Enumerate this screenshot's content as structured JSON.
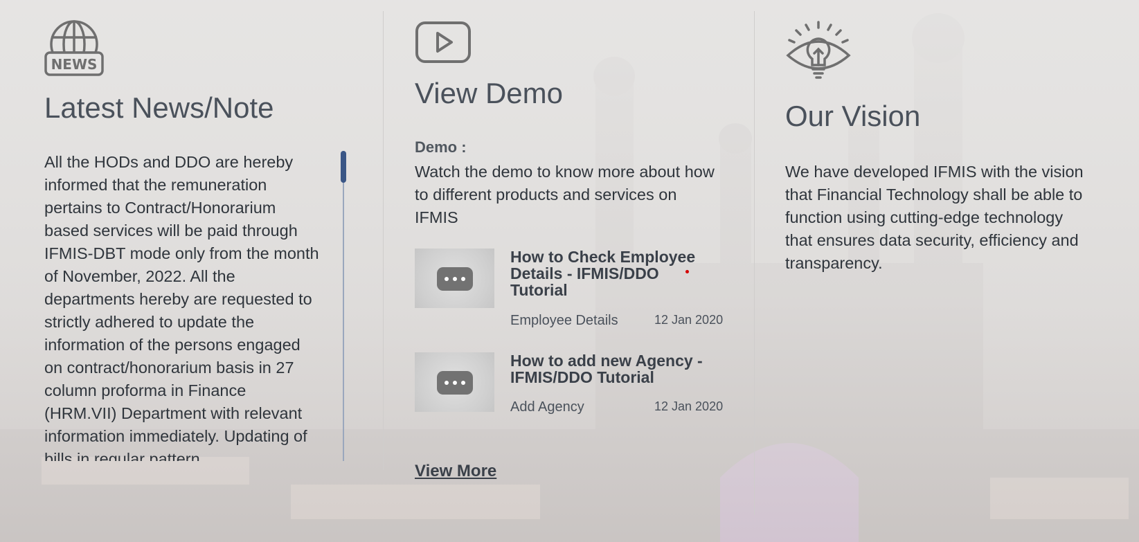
{
  "news": {
    "icon": "news-globe-icon",
    "icon_label": "NEWS",
    "title": "Latest News/Note",
    "body": "All the HODs and DDO are hereby informed that the remuneration pertains to Contract/Honorarium based services will be paid through IFMIS-DBT mode only from the month of November, 2022. All the departments hereby are requested to strictly adhered to update the information of the persons engaged on contract/honorarium basis in 27 column proforma in Finance (HRM.VII) Department with relevant information immediately. Updating of bills in regular pattern"
  },
  "demo": {
    "icon": "play-video-icon",
    "title": "View Demo",
    "heading": "Demo :",
    "description": "Watch the demo to know more about how to different products and services on IFMIS",
    "videos": [
      {
        "title": "How to Check Employee Details - IFMIS/DDO Tutorial",
        "category": "Employee Details",
        "date": "12 Jan 2020",
        "thumb_icon": "chat-bubble-icon"
      },
      {
        "title": "How to add new Agency - IFMIS/DDO Tutorial",
        "category": "Add Agency",
        "date": "12 Jan 2020",
        "thumb_icon": "chat-bubble-icon"
      }
    ],
    "view_more": "View More"
  },
  "vision": {
    "icon": "eye-lightbulb-icon",
    "title": "Our Vision",
    "body": "We have developed IFMIS with the vision that Financial Technology shall be able to function using cutting-edge technology that ensures data security, efficiency and transparency."
  },
  "colors": {
    "background": "#e7e6e5",
    "heading": "#4a515b",
    "body_text": "#2f353c",
    "scroll_thumb": "#3a5686",
    "scroll_track": "#9aa7bd"
  }
}
